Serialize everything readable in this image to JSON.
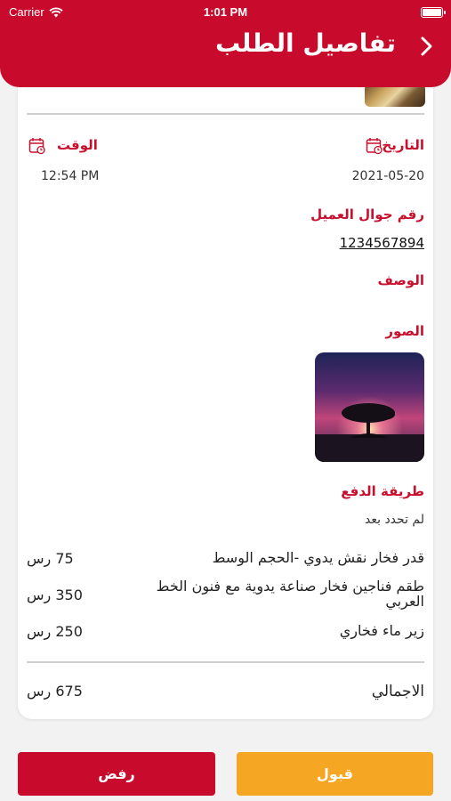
{
  "status_bar": {
    "carrier": "Carrier",
    "time": "1:01 PM"
  },
  "header": {
    "title": "تفاصيل الطلب"
  },
  "details": {
    "date_label": "التاريخ",
    "date_value": "2021-05-20",
    "time_label": "الوقت",
    "time_value": "12:54 PM",
    "phone_label": "رقم جوال العميل",
    "phone_value": "1234567894",
    "description_label": "الوصف",
    "photos_label": "الصور",
    "payment_label": "طريقة الدفع",
    "payment_value": "لم تحدد بعد"
  },
  "items": [
    {
      "name": "قدر فخار نقش يدوي -الحجم الوسط",
      "price": "75 رس"
    },
    {
      "name": "طقم فناجين فخار صناعة يدوية مع فنون الخط العربي",
      "price": "350 رس"
    },
    {
      "name": "زير ماء فخاري",
      "price": "250 رس"
    }
  ],
  "total": {
    "label": "الاجمالي",
    "value": "675 رس"
  },
  "actions": {
    "reject_label": "رفض",
    "accept_label": "قبول"
  },
  "colors": {
    "primary": "#c80a2c",
    "accent": "#f5a623"
  }
}
